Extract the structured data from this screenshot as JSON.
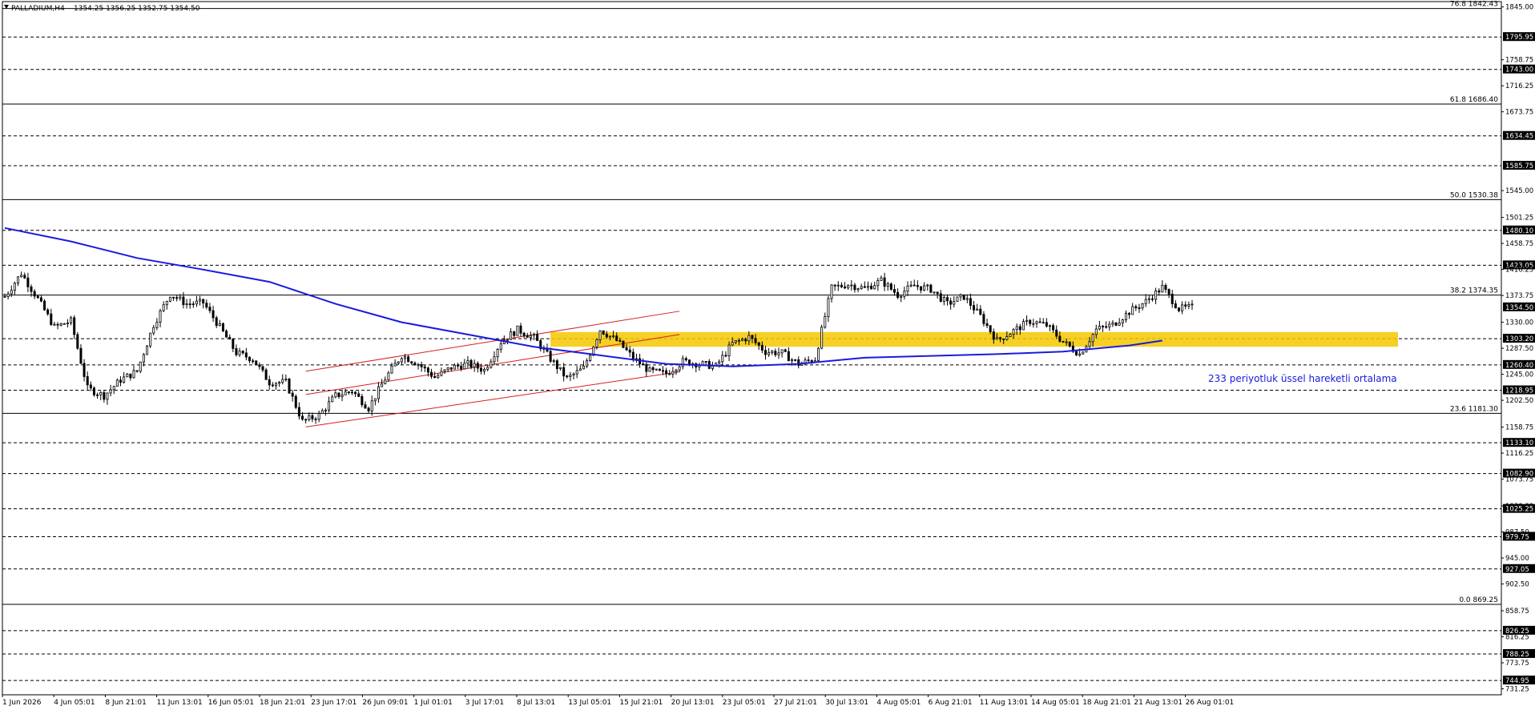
{
  "header": {
    "symbol": "PALLADIUM,H4",
    "ohlc": "1354.25 1356.25 1352.75 1354.50"
  },
  "annotation": {
    "ema_label": "233 periyotluk üssel hareketli ortalama"
  },
  "colors": {
    "candle": "#000000",
    "ema": "#1a1ae0",
    "channel": "#d32020",
    "zone": "#f5c800",
    "ema_text": "#1a1ae0",
    "grid": "#000000",
    "price_label_bg": "#000000",
    "price_label_text": "#ffffff"
  },
  "chart_data": {
    "type": "candlestick",
    "title": "PALLADIUM,H4",
    "ylim": [
      721.5,
      1848.5
    ],
    "y_ticks": [
      1845.0,
      1795.95,
      1758.75,
      1743.0,
      1716.25,
      1673.75,
      1634.45,
      1585.75,
      1545.0,
      1501.25,
      1480.1,
      1458.75,
      1423.05,
      1416.25,
      1373.75,
      1354.5,
      1330.0,
      1303.2,
      1287.5,
      1260.4,
      1245.0,
      1218.95,
      1202.5,
      1158.75,
      1133.1,
      1116.25,
      1082.9,
      1073.75,
      1030.0,
      1025.25,
      987.5,
      979.75,
      945.0,
      927.05,
      902.5,
      858.75,
      826.25,
      816.25,
      788.25,
      773.75,
      744.95,
      731.25
    ],
    "boxed_levels": [
      1795.95,
      1743.0,
      1634.45,
      1585.75,
      1480.1,
      1423.05,
      1354.5,
      1303.2,
      1260.4,
      1218.95,
      1133.1,
      1082.9,
      1025.25,
      979.75,
      927.05,
      826.25,
      788.25,
      744.95
    ],
    "dashed_levels": [
      1795.95,
      1743.0,
      1634.45,
      1585.75,
      1480.1,
      1423.05,
      1303.2,
      1260.4,
      1218.95,
      1133.1,
      1082.9,
      1025.25,
      979.75,
      927.05,
      826.25,
      788.25,
      744.95
    ],
    "fibonacci": [
      {
        "label": "76.8 1842.43",
        "price": 1842.43
      },
      {
        "label": "61.8 1686.40",
        "price": 1686.4
      },
      {
        "label": "50.0 1530.38",
        "price": 1530.38
      },
      {
        "label": "38.2 1374.35",
        "price": 1374.35
      },
      {
        "label": "23.6 1181.30",
        "price": 1181.3
      },
      {
        "label": "0.0 869.25",
        "price": 869.25
      }
    ],
    "x_labels": [
      "1 Jun 2026",
      "4 Jun 05:01",
      "8 Jun 21:01",
      "11 Jun 13:01",
      "16 Jun 05:01",
      "18 Jun 21:01",
      "23 Jun 17:01",
      "26 Jun 09:01",
      "1 Jul 01:01",
      "3 Jul 17:01",
      "8 Jul 13:01",
      "13 Jul 05:01",
      "15 Jul 21:01",
      "20 Jul 13:01",
      "23 Jul 05:01",
      "27 Jul 21:01",
      "30 Jul 13:01",
      "4 Aug 05:01",
      "6 Aug 21:01",
      "11 Aug 13:01",
      "14 Aug 05:01",
      "18 Aug 21:01",
      "21 Aug 13:01",
      "26 Aug 01:01"
    ],
    "close_path": [
      [
        0,
        1372
      ],
      [
        5,
        1410
      ],
      [
        10,
        1368
      ],
      [
        15,
        1322
      ],
      [
        20,
        1332
      ],
      [
        25,
        1222
      ],
      [
        30,
        1210
      ],
      [
        35,
        1236
      ],
      [
        40,
        1250
      ],
      [
        45,
        1326
      ],
      [
        50,
        1376
      ],
      [
        55,
        1360
      ],
      [
        60,
        1362
      ],
      [
        65,
        1322
      ],
      [
        70,
        1280
      ],
      [
        75,
        1270
      ],
      [
        80,
        1232
      ],
      [
        85,
        1232
      ],
      [
        90,
        1168
      ],
      [
        95,
        1178
      ],
      [
        100,
        1210
      ],
      [
        105,
        1218
      ],
      [
        110,
        1190
      ],
      [
        115,
        1238
      ],
      [
        120,
        1276
      ],
      [
        125,
        1262
      ],
      [
        130,
        1240
      ],
      [
        135,
        1256
      ],
      [
        140,
        1262
      ],
      [
        145,
        1252
      ],
      [
        150,
        1298
      ],
      [
        155,
        1318
      ],
      [
        160,
        1305
      ],
      [
        165,
        1270
      ],
      [
        170,
        1238
      ],
      [
        175,
        1255
      ],
      [
        180,
        1318
      ],
      [
        185,
        1300
      ],
      [
        190,
        1272
      ],
      [
        195,
        1250
      ],
      [
        200,
        1246
      ],
      [
        205,
        1266
      ],
      [
        210,
        1262
      ],
      [
        215,
        1258
      ],
      [
        220,
        1295
      ],
      [
        225,
        1306
      ],
      [
        230,
        1282
      ],
      [
        235,
        1280
      ],
      [
        240,
        1262
      ],
      [
        245,
        1270
      ],
      [
        250,
        1386
      ],
      [
        255,
        1392
      ],
      [
        260,
        1385
      ],
      [
        265,
        1398
      ],
      [
        270,
        1375
      ],
      [
        275,
        1390
      ],
      [
        280,
        1384
      ],
      [
        285,
        1360
      ],
      [
        290,
        1372
      ],
      [
        295,
        1340
      ],
      [
        300,
        1300
      ],
      [
        305,
        1316
      ],
      [
        310,
        1332
      ],
      [
        315,
        1325
      ],
      [
        320,
        1298
      ],
      [
        325,
        1278
      ],
      [
        330,
        1318
      ],
      [
        335,
        1326
      ],
      [
        340,
        1347
      ],
      [
        345,
        1364
      ],
      [
        350,
        1387
      ],
      [
        355,
        1352
      ],
      [
        359,
        1354.5
      ]
    ],
    "ema233_path": [
      [
        0,
        1484
      ],
      [
        20,
        1462
      ],
      [
        40,
        1435
      ],
      [
        60,
        1416
      ],
      [
        80,
        1396
      ],
      [
        100,
        1360
      ],
      [
        120,
        1330
      ],
      [
        140,
        1310
      ],
      [
        160,
        1290
      ],
      [
        180,
        1276
      ],
      [
        200,
        1262
      ],
      [
        220,
        1258
      ],
      [
        240,
        1262
      ],
      [
        260,
        1272
      ],
      [
        280,
        1275
      ],
      [
        300,
        1278
      ],
      [
        320,
        1282
      ],
      [
        340,
        1292
      ],
      [
        350,
        1300
      ]
    ],
    "channel": {
      "upper": [
        [
          91,
          1250
        ],
        [
          204,
          1348
        ]
      ],
      "middle": [
        [
          91,
          1212
        ],
        [
          204,
          1310
        ]
      ],
      "lower": [
        [
          91,
          1159
        ],
        [
          204,
          1249
        ]
      ]
    },
    "zone": {
      "from": 1290,
      "to": 1314,
      "x_start": 165
    }
  }
}
